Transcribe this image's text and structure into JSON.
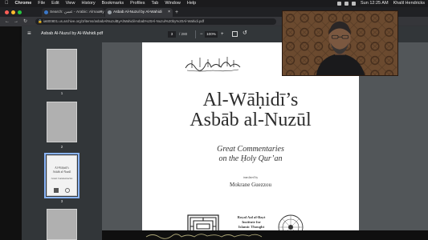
{
  "menubar": {
    "app": "Chrome",
    "items": [
      "File",
      "Edit",
      "View",
      "History",
      "Bookmarks",
      "Profiles",
      "Tab",
      "Window",
      "Help"
    ],
    "datetime": "Sun 12:25 AM",
    "user": "Khalil Hendricks"
  },
  "tabs": [
    {
      "title": "Search: عسن - Arabic: Almaany",
      "active": false
    },
    {
      "title": "Asbab Al-Nuzul by Al-Wahidi",
      "active": true
    }
  ],
  "address_bar": {
    "url": "ia600801.us.archive.org/3/items/asbabAlNuzulByAlWahidi/Asbab%20Al-Nuzul%20by%20Al-Wahidi.pdf"
  },
  "pdf_toolbar": {
    "file_name": "Asbab Al-Nuzul by Al-Wahidi.pdf",
    "current_page": "3",
    "total_pages": "/ 280",
    "zoom": "100%"
  },
  "thumbnails": [
    {
      "number": "1",
      "selected": false
    },
    {
      "number": "2",
      "selected": false
    },
    {
      "number": "3",
      "selected": true
    }
  ],
  "page": {
    "title_line1": "Al-Wāḥidī’s",
    "title_line2": "Asbāb al-Nuzūl",
    "subtitle_line1": "Great Commentaries",
    "subtitle_line2": "on the Ḥoly Qur’an",
    "translated_by": "translated by",
    "translator": "Mokrane Guezzou",
    "publisher_line1": "Royal Aal al-Bayt",
    "publisher_line2": "Institute for",
    "publisher_line3": "Islamic Thought"
  },
  "colors": {
    "pdf_toolbar": "#323639",
    "viewer_bg": "#525659",
    "selection": "#8ab4f8"
  }
}
